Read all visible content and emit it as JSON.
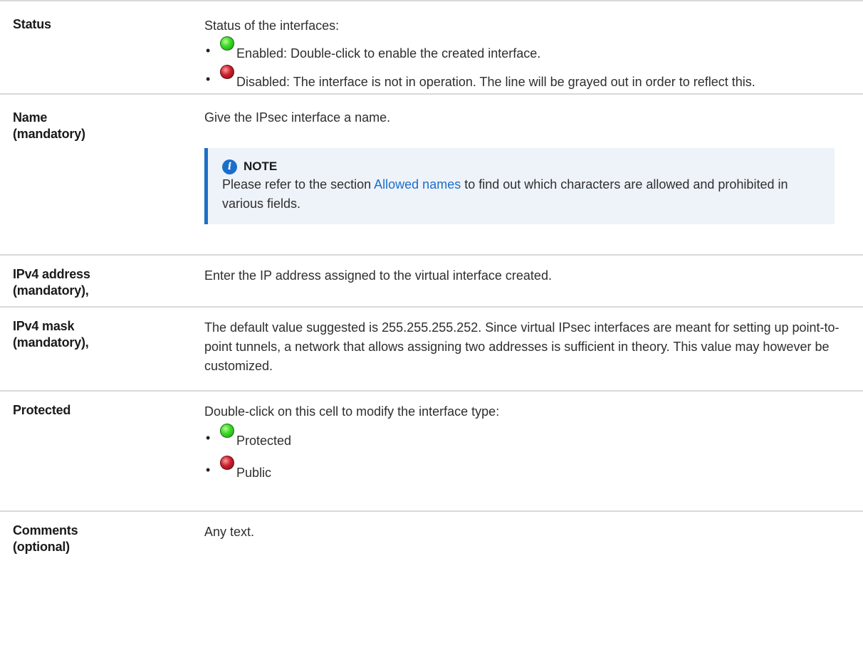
{
  "rows": [
    {
      "label": "Status",
      "intro": "Status of the interfaces:",
      "items": [
        {
          "icon": "green-status-icon",
          "text": "Enabled: Double-click to enable the created interface."
        },
        {
          "icon": "red-status-icon",
          "text": "Disabled: The interface is not in operation. The line will be grayed out in order to reflect this."
        }
      ]
    },
    {
      "label": "Name",
      "label2": "(mandatory)",
      "text": "Give the IPsec interface a name.",
      "note": {
        "icon": "info-icon",
        "title": "NOTE",
        "text_before": "Please refer to the section ",
        "link": "Allowed names",
        "text_after": " to find out which characters are allowed and prohibited in various fields."
      }
    },
    {
      "label": "IPv4 address",
      "label2": "(mandatory),",
      "text": "Enter the IP address assigned to the virtual interface created."
    },
    {
      "label": "IPv4 mask",
      "label2": "(mandatory),",
      "text": "The default value suggested is 255.255.255.252. Since virtual IPsec interfaces are meant for setting up point-to-point tunnels, a network that allows assigning two addresses is sufficient in theory. This value may however be customized."
    },
    {
      "label": "Protected",
      "intro": "Double-click on this cell to modify the interface type:",
      "items": [
        {
          "icon": "green-status-icon",
          "text": "Protected"
        },
        {
          "icon": "red-status-icon",
          "text": "Public"
        }
      ]
    },
    {
      "label": "Comments",
      "label2": "(optional)",
      "text": "Any text."
    }
  ],
  "bullet": "•",
  "colors": {
    "link": "#1c6fc8",
    "note_background": "#eef3fa",
    "note_border": "#1c6fc8",
    "enabled": "#3fdc2b",
    "disabled": "#cc1f2d"
  }
}
